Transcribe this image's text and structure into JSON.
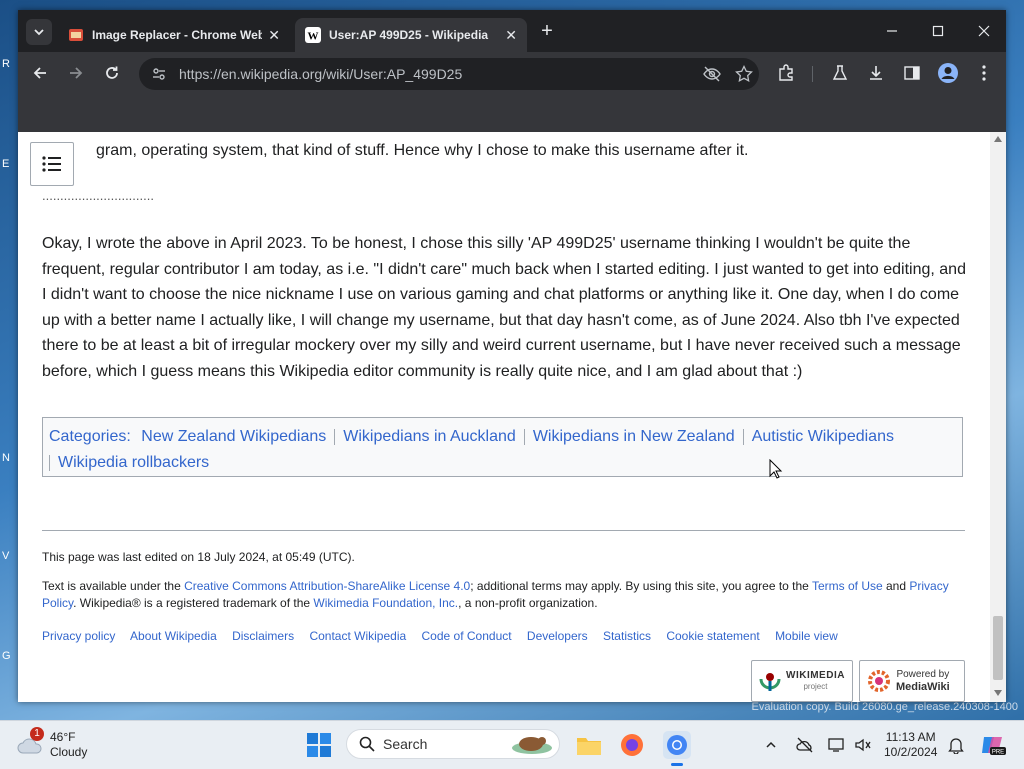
{
  "browser": {
    "tabs": [
      {
        "title": "Image Replacer - Chrome Web",
        "active": false
      },
      {
        "title": "User:AP 499D25 - Wikipedia",
        "active": true
      }
    ],
    "url": "https://en.wikipedia.org/wiki/User:AP_499D25"
  },
  "article": {
    "top_partial": "gram, operating system, that kind of stuff. Hence why I chose to make this username after it.",
    "dots": "...............................",
    "paragraph": "Okay, I wrote the above in April 2023. To be honest, I chose this silly 'AP 499D25' username thinking I wouldn't be quite the frequent, regular contributor I am today, as i.e. \"I didn't care\" much back when I started editing. I just wanted to get into editing, and I didn't want to choose the nice nickname I use on various gaming and chat platforms or anything like it. One day, when I do come up with a better name I actually like, I will change my username, but that day hasn't come, as of June 2024. Also tbh I've expected there to be at least a bit of irregular mockery over my silly and weird current username, but I have never received such a message before, which I guess means this Wikipedia editor community is really quite nice, and I am glad about that :)"
  },
  "categories": {
    "label": "Categories",
    "items": [
      "New Zealand Wikipedians",
      "Wikipedians in Auckland",
      "Wikipedians in New Zealand",
      "Autistic Wikipedians",
      "Wikipedia rollbackers"
    ]
  },
  "footer": {
    "last_edited": "This page was last edited on 18 July 2024, at 05:49 (UTC).",
    "license_pre": "Text is available under the ",
    "license_link": "Creative Commons Attribution-ShareAlike License 4.0",
    "license_mid": "; additional terms may apply. By using this site, you agree to the ",
    "terms_link": "Terms of Use",
    "and": " and ",
    "privacy_link": "Privacy Policy",
    "trademark_pre": ". Wikipedia® is a registered trademark of the ",
    "foundation_link": "Wikimedia Foundation, Inc.",
    "trademark_post": ", a non-profit organization.",
    "links": [
      "Privacy policy",
      "About Wikipedia",
      "Disclaimers",
      "Contact Wikipedia",
      "Code of Conduct",
      "Developers",
      "Statistics",
      "Cookie statement",
      "Mobile view"
    ],
    "wikimedia_badge": {
      "line1": "WIKIMEDIA",
      "line2": "project"
    },
    "mediawiki_badge": {
      "line1": "Powered by",
      "line2": "MediaWiki"
    }
  },
  "desktop": {
    "eval_text": "Evaluation copy. Build 26080.ge_release.240308-1400"
  },
  "taskbar": {
    "weather": {
      "temp": "46°F",
      "condition": "Cloudy",
      "badge": "1"
    },
    "search_placeholder": "Search",
    "clock": {
      "time": "11:13 AM",
      "date": "10/2/2024"
    }
  },
  "colors": {
    "link": "#3366cc",
    "tabbar": "#202124",
    "toolbar": "#35363a"
  }
}
